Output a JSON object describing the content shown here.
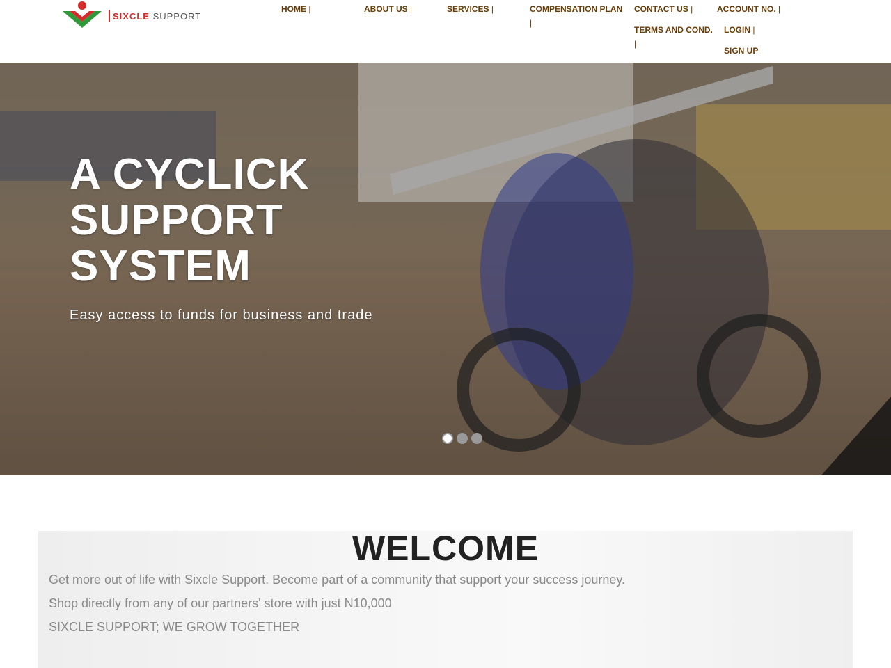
{
  "logo": {
    "brand": "SIXCLE",
    "suffix": " SUPPORT",
    "icon": "person-chevron-logo-icon"
  },
  "nav": {
    "home": "HOME",
    "about": "ABOUT US",
    "services": "SERVICES",
    "compensation": "COMPENSATION PLAN",
    "contact": "CONTACT US",
    "account": "ACCOUNT NO.",
    "terms": "TERMS AND COND.",
    "login": "LOGIN",
    "signup": "SIGN UP",
    "separator": "|"
  },
  "hero": {
    "title": "A CYCLICK SUPPORT SYSTEM",
    "subtitle": "Easy access to funds for business and trade",
    "slides": 3,
    "active_slide": 1
  },
  "welcome": {
    "title": "WELCOME",
    "line1": "Get more out of life with Sixcle Support. Become part of a community that support your success journey.",
    "line2": "Shop directly from any of our partners' store with just N10,000",
    "line3": "SIXCLE SUPPORT; WE GROW TOGETHER"
  },
  "colors": {
    "nav_text": "#6a3d08",
    "brand_red": "#d42b2b",
    "brand_green": "#2e9a3a"
  }
}
